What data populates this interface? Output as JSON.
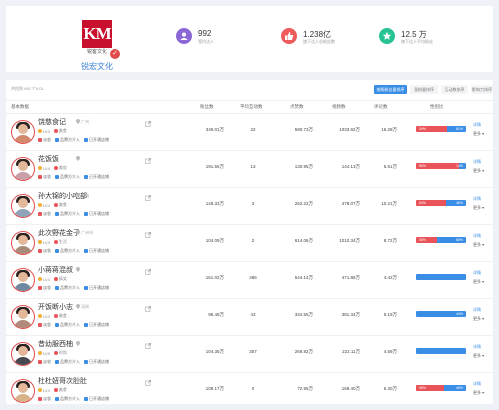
{
  "brand": {
    "logo_text": "KM",
    "logo_sub": "锐客文化",
    "name": "锐宏文化"
  },
  "stats": [
    {
      "value": "992",
      "label": "签约达人",
      "color": "#8a68d6",
      "icon": "users-icon"
    },
    {
      "value": "1.238亿",
      "label": "旗下达人总粉丝数",
      "color": "#ef5b5b",
      "icon": "thumb-icon"
    },
    {
      "value": "12.5 万",
      "label": "旗下达人平均粉丝",
      "color": "#27c393",
      "icon": "star-icon"
    }
  ],
  "breadcrumb": "共找到 992 个KOL",
  "tabs": [
    "按照粉丝量排序",
    "涨粉量排序",
    "互动数排序",
    "影响力排序"
  ],
  "table": {
    "headers": [
      "基本数据",
      "粉丝数",
      "平均互动数",
      "点赞数",
      "视频数",
      "评论数",
      "性别比"
    ],
    "rows": [
      {
        "name": "饶慈食记",
        "loc": "广州",
        "level": "LV3",
        "tag": "美食",
        "fans": "345.01万",
        "interact": "22",
        "likes": "590.73万",
        "videos": "1033.92万",
        "comments": "16.28万",
        "male": 0.62,
        "male_label": "39%",
        "female_label": "61%",
        "avatar": "#d48a6a"
      },
      {
        "name": "花饭饭",
        "loc": "",
        "level": "LV4",
        "tag": "美妆",
        "fans": "191.56万",
        "interact": "13",
        "likes": "130.95万",
        "videos": "144.13万",
        "comments": "5.61万",
        "male": 0.86,
        "male_label": "86%",
        "female_label": "14%",
        "avatar": "#c9a0a8"
      },
      {
        "name": "孙大锦的小吃部",
        "loc": "上海",
        "level": "LV4",
        "tag": "美食",
        "fans": "148.33万",
        "interact": "3",
        "likes": "262.22万",
        "videos": "478.07万",
        "comments": "10.21万",
        "male": 0.6,
        "male_label": "54%",
        "female_label": "46%",
        "avatar": "#8fa2b8"
      },
      {
        "name": "此次野花金子",
        "loc": "广州市",
        "level": "LV3",
        "tag": "生活",
        "fans": "104.09万",
        "interact": "2",
        "likes": "614.06万",
        "videos": "1010.34万",
        "comments": "8.72万",
        "male": 0.42,
        "male_label": "35%",
        "female_label": "65%",
        "avatar": "#a88a78"
      },
      {
        "name": "小蒋蒋混叔",
        "loc": "",
        "level": "LV4",
        "tag": "搞笑",
        "fans": "161.02万",
        "interact": "286",
        "likes": "544.14万",
        "videos": "471.88万",
        "comments": "4.42万",
        "male": 0.0,
        "male_label": "",
        "female_label": "",
        "avatar": "#6f8aa0"
      },
      {
        "name": "开饭断小志",
        "loc": "深圳",
        "level": "LV3",
        "tag": "美食",
        "fans": "98.48万",
        "interact": "43",
        "likes": "334.55万",
        "videos": "381.34万",
        "comments": "5.19万",
        "male": 0.0,
        "male_label": "",
        "female_label": "44%",
        "avatar": "#b08a7a"
      },
      {
        "name": "昔幼服西柚",
        "loc": "",
        "level": "LV5",
        "tag": "时尚",
        "fans": "104.35万",
        "interact": "357",
        "likes": "269.82万",
        "videos": "222.11万",
        "comments": "4.69万",
        "male": 0.0,
        "male_label": "",
        "female_label": "",
        "avatar": "#45484e"
      },
      {
        "name": "杜杜妞哥次肚肚",
        "loc": "",
        "level": "LV4",
        "tag": "美食",
        "fans": "109.17万",
        "interact": "0",
        "likes": "72.95万",
        "videos": "168.40万",
        "comments": "6.30万",
        "male": 0.55,
        "male_label": "55%",
        "female_label": "45%",
        "avatar": "#d8b28a"
      }
    ]
  },
  "row_meta": {
    "tag_a": "美食",
    "tag_b": "北京",
    "link_a": "品牌方介入",
    "link_b": "已开通店铺",
    "link_c": "淡妆"
  },
  "actions": {
    "detail": "详情",
    "more": "更多"
  }
}
